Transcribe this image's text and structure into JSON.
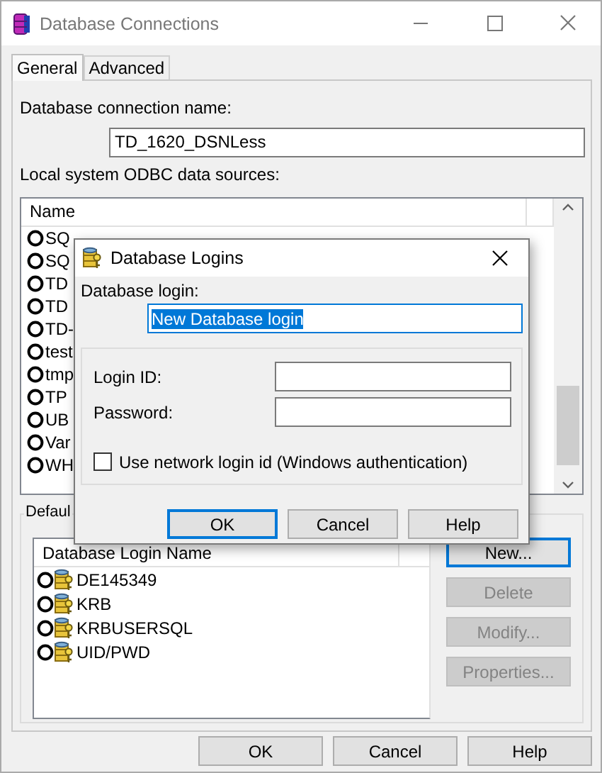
{
  "window": {
    "title": "Database Connections"
  },
  "tabs": [
    {
      "label": "General",
      "selected": true
    },
    {
      "label": "Advanced",
      "selected": false
    }
  ],
  "connection_name": {
    "label": "Database connection name:",
    "value": "TD_1620_DSNLess"
  },
  "data_sources": {
    "label": "Local system ODBC data sources:",
    "columns": [
      "Name"
    ],
    "rows": [
      "SQ",
      "SQ",
      "TD",
      "TD",
      "TD-",
      "test",
      "tmp",
      "TP",
      "UB",
      "Var",
      "WH"
    ]
  },
  "default_login": {
    "label": "Defaul",
    "columns": [
      "Database Login Name"
    ],
    "rows": [
      "DE145349",
      "KRB",
      "KRBUSERSQL",
      "UID/PWD"
    ],
    "buttons": [
      {
        "label": "New...",
        "disabled": false,
        "focused": true
      },
      {
        "label": "Delete",
        "disabled": true,
        "focused": false
      },
      {
        "label": "Modify...",
        "disabled": true,
        "focused": false
      },
      {
        "label": "Properties...",
        "disabled": true,
        "focused": false
      }
    ]
  },
  "buttons": [
    {
      "label": "OK",
      "focused": false
    },
    {
      "label": "Cancel",
      "focused": false
    },
    {
      "label": "Help",
      "focused": false
    }
  ],
  "login_dialog": {
    "title": "Database Logins",
    "login_label": "Database login:",
    "login_value": "New Database login",
    "text_selected": true,
    "fields": [
      {
        "label": "Login ID:"
      },
      {
        "label": "Password:"
      }
    ],
    "checkbox": {
      "label": "Use network login id (Windows authentication)",
      "checked": false
    },
    "buttons": [
      {
        "label": "OK",
        "focused": true
      },
      {
        "label": "Cancel",
        "focused": false
      },
      {
        "label": "Help",
        "focused": false
      }
    ]
  }
}
